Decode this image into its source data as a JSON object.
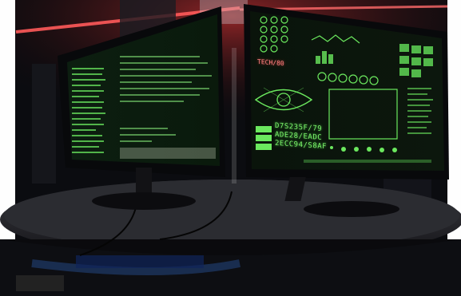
{
  "scene": {
    "description_label": "Dual monitor hacker workstation",
    "right_monitor": {
      "red_label": "TECH/80",
      "codes": [
        "D7S235F/79",
        "ADE28/EADC",
        "2ECC94/S8AF"
      ]
    }
  },
  "colors": {
    "screen_green": "#7cf26a",
    "ambient_red": "#ff4040",
    "background": "#0b0c10"
  }
}
